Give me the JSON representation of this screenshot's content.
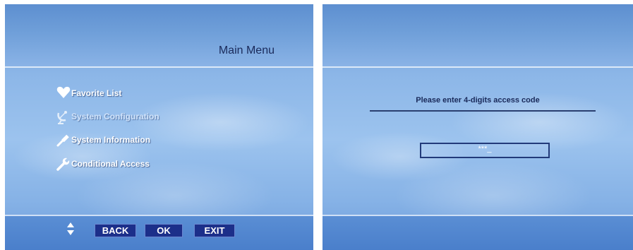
{
  "main_menu": {
    "title": "Main Menu",
    "items": [
      {
        "label": "Favorite List",
        "icon": "heart-icon"
      },
      {
        "label": "System Configuration",
        "icon": "satellite-dish-icon"
      },
      {
        "label": "System Information",
        "icon": "screwdriver-icon"
      },
      {
        "label": "Conditional Access",
        "icon": "wrench-icon"
      }
    ],
    "selected_index": 1
  },
  "footer": {
    "nav_icon": "up-down-arrows-icon",
    "keys": [
      "BACK",
      "OK",
      "EXIT"
    ]
  },
  "access_dialog": {
    "prompt": "Please enter 4-digits access code",
    "code_value": "***_"
  },
  "colors": {
    "key_background": "#1c2f8a",
    "title_text": "#1a2a5a",
    "menu_text": "#ffffff"
  }
}
